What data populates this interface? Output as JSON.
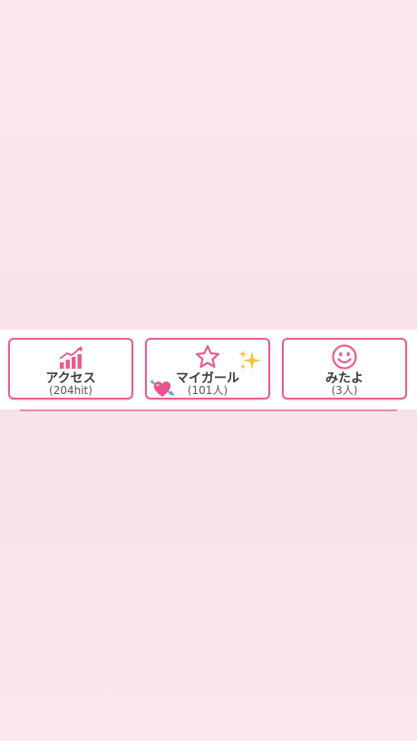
{
  "cards": [
    {
      "label": "アクセス",
      "sub": "(204hit)",
      "icon": "chart-bars-icon"
    },
    {
      "label": "マイガール",
      "sub": "(101人)",
      "icon": "star-outline-icon"
    },
    {
      "label": "みたよ",
      "sub": "(3人)",
      "icon": "smiley-face-icon"
    }
  ],
  "decorations": {
    "sparkle": "sparkles-icon",
    "heart": "heart-with-arrow-icon"
  },
  "colors": {
    "accent": "#e85c8f",
    "sparkle": "#f3c53d",
    "heart": "#e8548a"
  }
}
